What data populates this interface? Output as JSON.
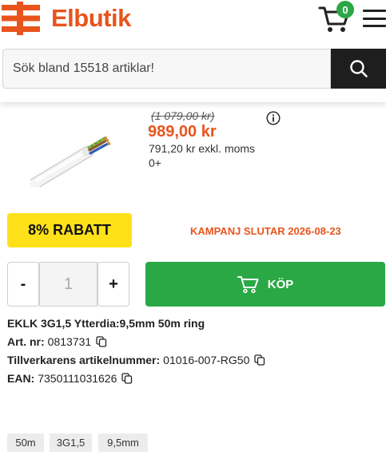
{
  "header": {
    "brand": "Elbutik",
    "cart_count": "0",
    "brand_color": "#e8541c"
  },
  "search": {
    "placeholder": "Sök bland 15518 artiklar!"
  },
  "product": {
    "price_old": "(1 079,00 kr)",
    "price_current": "989,00 kr",
    "price_excl": "791,20 kr exkl. moms",
    "stock": "0+",
    "discount": "8% RABATT",
    "campaign": "KAMPANJ SLUTAR 2026-08-23",
    "title": "EKLK 3G1,5 Ytterdia:9,5mm 50m ring",
    "article_label": "Art. nr:",
    "article_value": "0813731",
    "manufacturer_label": "Tillverkarens artikelnummer:",
    "manufacturer_value": "01016-007-RG50",
    "ean_label": "EAN:",
    "ean_value": "7350111031626",
    "tags": [
      "50m",
      "3G1,5",
      "9,5mm"
    ]
  },
  "quantity": {
    "minus_label": "-",
    "value": "1",
    "plus_label": "+"
  },
  "buy": {
    "label": "KÖP",
    "color": "#2aa845"
  },
  "icons": [
    "elbutik-logo-icon",
    "cart-icon",
    "menu-icon",
    "search-icon",
    "info-icon",
    "copy-icon"
  ]
}
